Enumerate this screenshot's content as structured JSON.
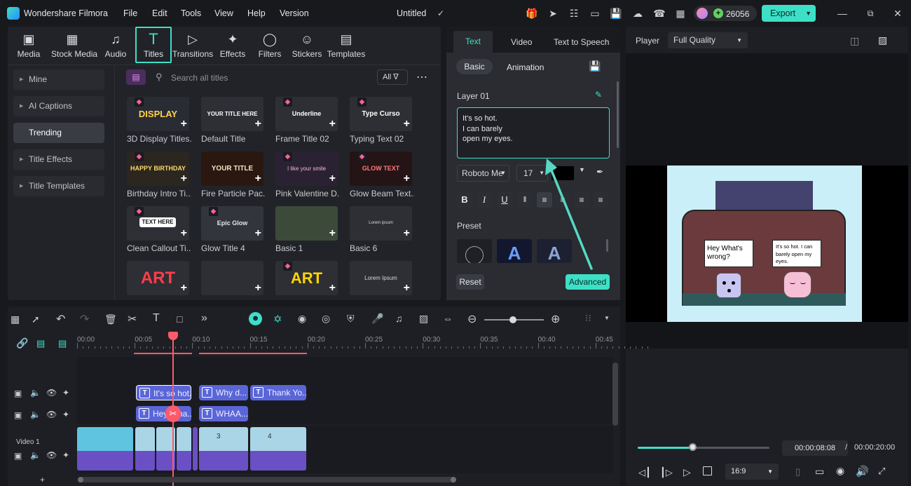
{
  "app": {
    "name": "Wondershare Filmora",
    "doc_title": "Untitled"
  },
  "menu": [
    "File",
    "Edit",
    "Tools",
    "View",
    "Help",
    "Version"
  ],
  "credits": "26056",
  "export_label": "Export",
  "media_tabs": [
    "Media",
    "Stock Media",
    "Audio",
    "Titles",
    "Transitions",
    "Effects",
    "Filters",
    "Stickers",
    "Templates"
  ],
  "sidebar": [
    "Mine",
    "AI Captions",
    "Trending",
    "Title Effects",
    "Title Templates"
  ],
  "search": {
    "placeholder": "Search all titles",
    "filter": "All"
  },
  "titles": [
    {
      "label": "3D Display Titles...",
      "thumb_text": "DISPLAY"
    },
    {
      "label": "Default Title",
      "thumb_text": "YOUR TITLE HERE"
    },
    {
      "label": "Frame Title 02",
      "thumb_text": "Underline"
    },
    {
      "label": "Typing Text 02",
      "thumb_text": "Type Curso"
    },
    {
      "label": "Birthday Intro Ti...",
      "thumb_text": "HAPPY BIRTHDAY"
    },
    {
      "label": "Fire Particle Pac...",
      "thumb_text": "YOUR TITLE"
    },
    {
      "label": "Pink Valentine D...",
      "thumb_text": "I like your smile"
    },
    {
      "label": "Glow Beam Text...",
      "thumb_text": "GLOW TEXT"
    },
    {
      "label": "Clean Callout Ti...",
      "thumb_text": "TEXT HERE"
    },
    {
      "label": "Glow Title 4",
      "thumb_text": "Epic Glow"
    },
    {
      "label": "Basic 1",
      "thumb_text": ""
    },
    {
      "label": "Basic 6",
      "thumb_text": "Lorem ipsum"
    },
    {
      "label": "",
      "thumb_text": "ART"
    },
    {
      "label": "",
      "thumb_text": ""
    },
    {
      "label": "",
      "thumb_text": "ART"
    },
    {
      "label": "",
      "thumb_text": "Lorem Ipsum"
    }
  ],
  "props": {
    "tabs": [
      "Text",
      "Video",
      "Text to Speech"
    ],
    "subtabs": [
      "Basic",
      "Animation"
    ],
    "layer": "Layer 01",
    "text_lines": [
      "It's so hot.",
      "I can barely",
      "open my eyes."
    ],
    "font": "Roboto Me",
    "size": "17",
    "preset_label": "Preset",
    "reset": "Reset",
    "advanced": "Advanced"
  },
  "player": {
    "label": "Player",
    "quality": "Full Quality",
    "bubble_left": "Hey What's wrong?",
    "bubble_right": "It's so hot. I can barely open my eyes.",
    "current_time": "00:00:08:08",
    "separator": "/",
    "total_time": "00:00:20:00",
    "aspect": "16:9",
    "progress": 0.415
  },
  "timeline": {
    "ruler": [
      "00:00",
      "00:05",
      "00:10",
      "00:15",
      "00:20",
      "00:25",
      "00:30",
      "00:35",
      "00:40",
      "00:45"
    ],
    "track1_clips": [
      "It's so hot.",
      "Why d...",
      "Thank Yo..."
    ],
    "track2_clips": [
      "Hey Wha...",
      "WHAA..."
    ],
    "video_track_label": "Video 1",
    "video_clip_numbers": [
      "3",
      "4"
    ]
  },
  "colors": {
    "accent": "#3de0c6",
    "clip": "#5a66d8",
    "playhead": "#ff5a6a"
  }
}
